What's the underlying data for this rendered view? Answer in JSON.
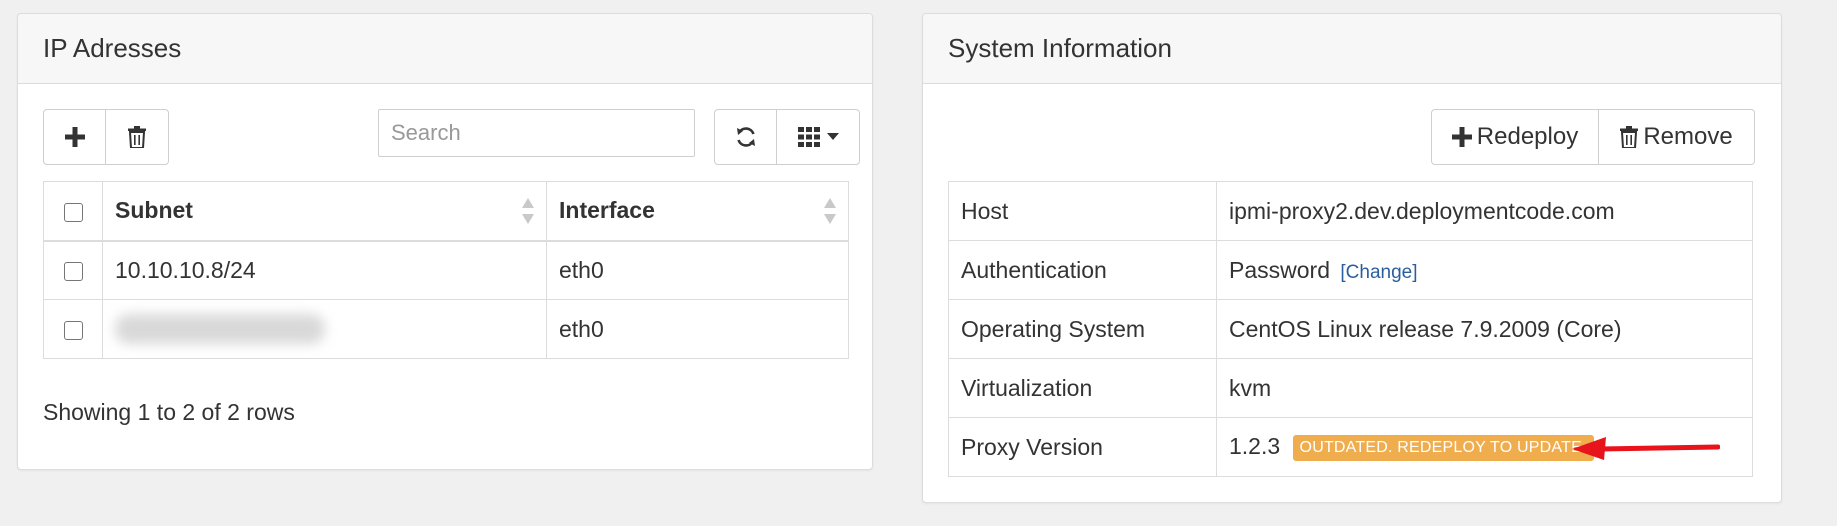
{
  "ip_panel": {
    "title": "IP Adresses",
    "search": {
      "placeholder": "Search",
      "value": ""
    },
    "columns": [
      "Subnet",
      "Interface"
    ],
    "rows": [
      {
        "subnet": "10.10.10.8/24",
        "interface": "eth0"
      },
      {
        "subnet": "",
        "interface": "eth0"
      }
    ],
    "rows_info": "Showing 1 to 2 of 2 rows"
  },
  "system_panel": {
    "title": "System Information",
    "redeploy_label": "Redeploy",
    "remove_label": "Remove",
    "rows": [
      {
        "label": "Host",
        "value": "ipmi-proxy2.dev.deploymentcode.com"
      },
      {
        "label": "Authentication",
        "value": "Password",
        "link": "[Change]"
      },
      {
        "label": "Operating System",
        "value": "CentOS Linux release 7.9.2009 (Core)"
      },
      {
        "label": "Virtualization",
        "value": "kvm"
      },
      {
        "label": "Proxy Version",
        "value": "1.2.3",
        "badge": "OUTDATED. REDEPLOY TO UPDATE."
      }
    ]
  },
  "icons": {
    "add": "plus-icon",
    "delete": "trash-icon",
    "refresh": "refresh-icon",
    "columns": "grid-columns-icon",
    "dropdown": "caret-down-icon",
    "sort": "sort-icon",
    "annotation": "red-arrow-icon"
  },
  "colors": {
    "badge": "#f0ad4e",
    "link": "#2a5f9e",
    "annotation_arrow": "#e8141b"
  }
}
